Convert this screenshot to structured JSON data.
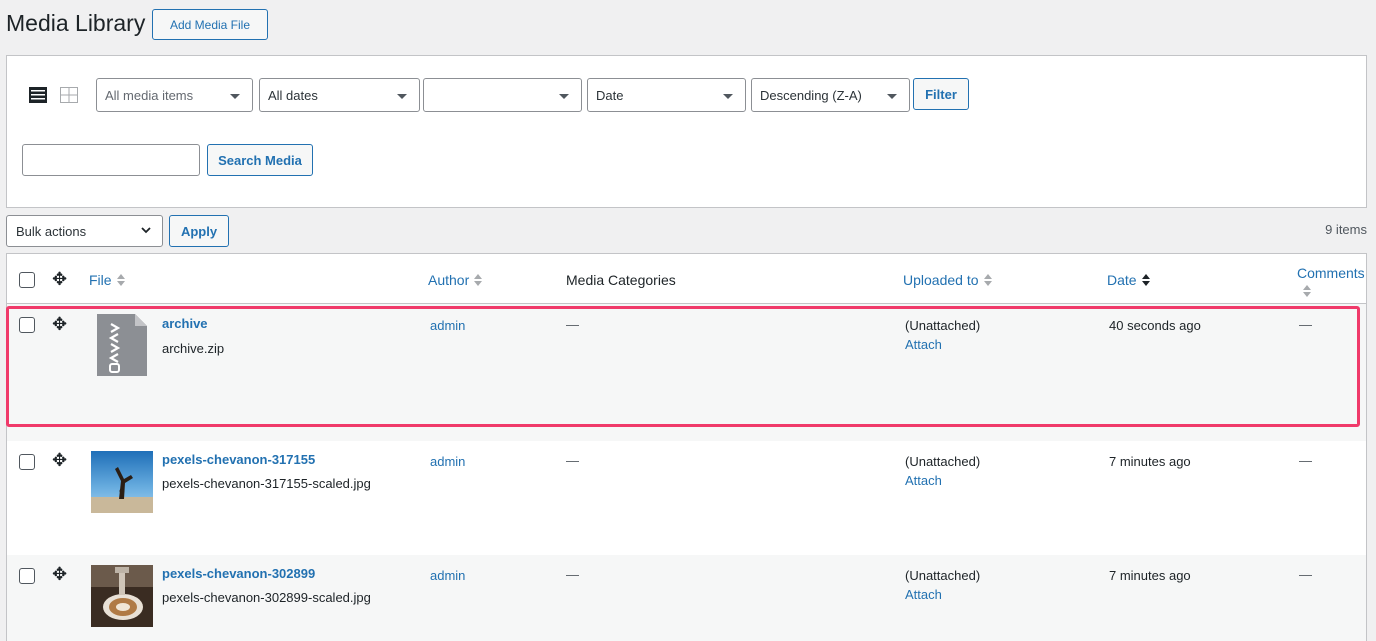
{
  "header": {
    "title": "Media Library",
    "add_button": "Add Media File"
  },
  "filters": {
    "media_type": "All media items",
    "dates": "All dates",
    "category": "",
    "orderby": "Date",
    "order": "Descending (Z-A)",
    "filter_button": "Filter",
    "search_placeholder": "",
    "search_button": "Search Media"
  },
  "bulk": {
    "select": "Bulk actions",
    "apply": "Apply",
    "count": "9 items"
  },
  "columns": {
    "file": "File",
    "author": "Author",
    "categories": "Media Categories",
    "uploaded_to": "Uploaded to",
    "date": "Date",
    "comments": "Comments"
  },
  "rows": [
    {
      "title": "archive",
      "filename": "archive.zip",
      "author": "admin",
      "categories": "—",
      "uploaded_to": "(Unattached)",
      "attach": "Attach",
      "date": "40 seconds ago",
      "comments": "—",
      "thumb": "zip-file-icon"
    },
    {
      "title": "pexels-chevanon-317155",
      "filename": "pexels-chevanon-317155-scaled.jpg",
      "author": "admin",
      "categories": "—",
      "uploaded_to": "(Unattached)",
      "attach": "Attach",
      "date": "7 minutes ago",
      "comments": "—",
      "thumb": "photo-yoga-beach"
    },
    {
      "title": "pexels-chevanon-302899",
      "filename": "pexels-chevanon-302899-scaled.jpg",
      "author": "admin",
      "categories": "—",
      "uploaded_to": "(Unattached)",
      "attach": "Attach",
      "date": "7 minutes ago",
      "comments": "—",
      "thumb": "photo-latte-art"
    }
  ],
  "colors": {
    "accent": "#2271b1",
    "highlight": "#f03a6a"
  }
}
